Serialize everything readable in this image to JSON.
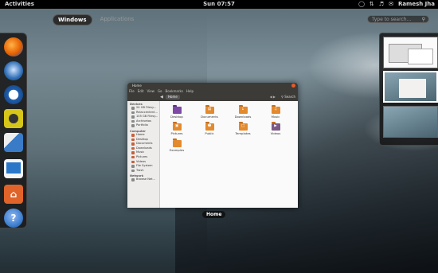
{
  "topbar": {
    "activities": "Activities",
    "clock": "Sun 07:57",
    "user": "Ramesh Jha",
    "tray_icons": [
      "accessibility-icon",
      "network-icon",
      "volume-icon",
      "mail-icon"
    ]
  },
  "overview": {
    "tabs": [
      "Windows",
      "Applications"
    ],
    "active_tab": "Windows",
    "search_placeholder": "Type to search..."
  },
  "dash": {
    "apps": [
      {
        "name": "firefox",
        "color": "#e66000"
      },
      {
        "name": "thunderbird",
        "color": "#2f6fb7"
      },
      {
        "name": "empathy",
        "color": "#1f5fb0"
      },
      {
        "name": "rhythmbox",
        "color": "#d6c619"
      },
      {
        "name": "shotwell",
        "color": "#3a7bc8"
      },
      {
        "name": "libreoffice-writer",
        "color": "#2a77c9"
      },
      {
        "name": "home-folder",
        "color": "#e0642a"
      },
      {
        "name": "help",
        "color": "#3f7fd0"
      }
    ]
  },
  "window": {
    "title": "Home",
    "caption": "Home",
    "menu": [
      "File",
      "Edit",
      "View",
      "Go",
      "Bookmarks",
      "Help"
    ],
    "breadcrumb": "Home",
    "search_label": "Search",
    "sidebar": [
      {
        "header": "Devices",
        "items": [
          "24 GB Filesy...",
          "Reiaccentent...",
          "105 GB Filesy...",
          "Archivetos",
          "Portfolio"
        ]
      },
      {
        "header": "Computer",
        "items": [
          "Home",
          "Desktop",
          "Documents",
          "Downloads",
          "Music",
          "Pictures",
          "Videos",
          "File System",
          "Trash"
        ]
      },
      {
        "header": "Network",
        "items": [
          "Browse Net..."
        ]
      }
    ],
    "files": [
      "Desktop",
      "Documents",
      "Downloads",
      "Music",
      "Pictures",
      "Public",
      "Templates",
      "Videos",
      "Examples"
    ]
  }
}
